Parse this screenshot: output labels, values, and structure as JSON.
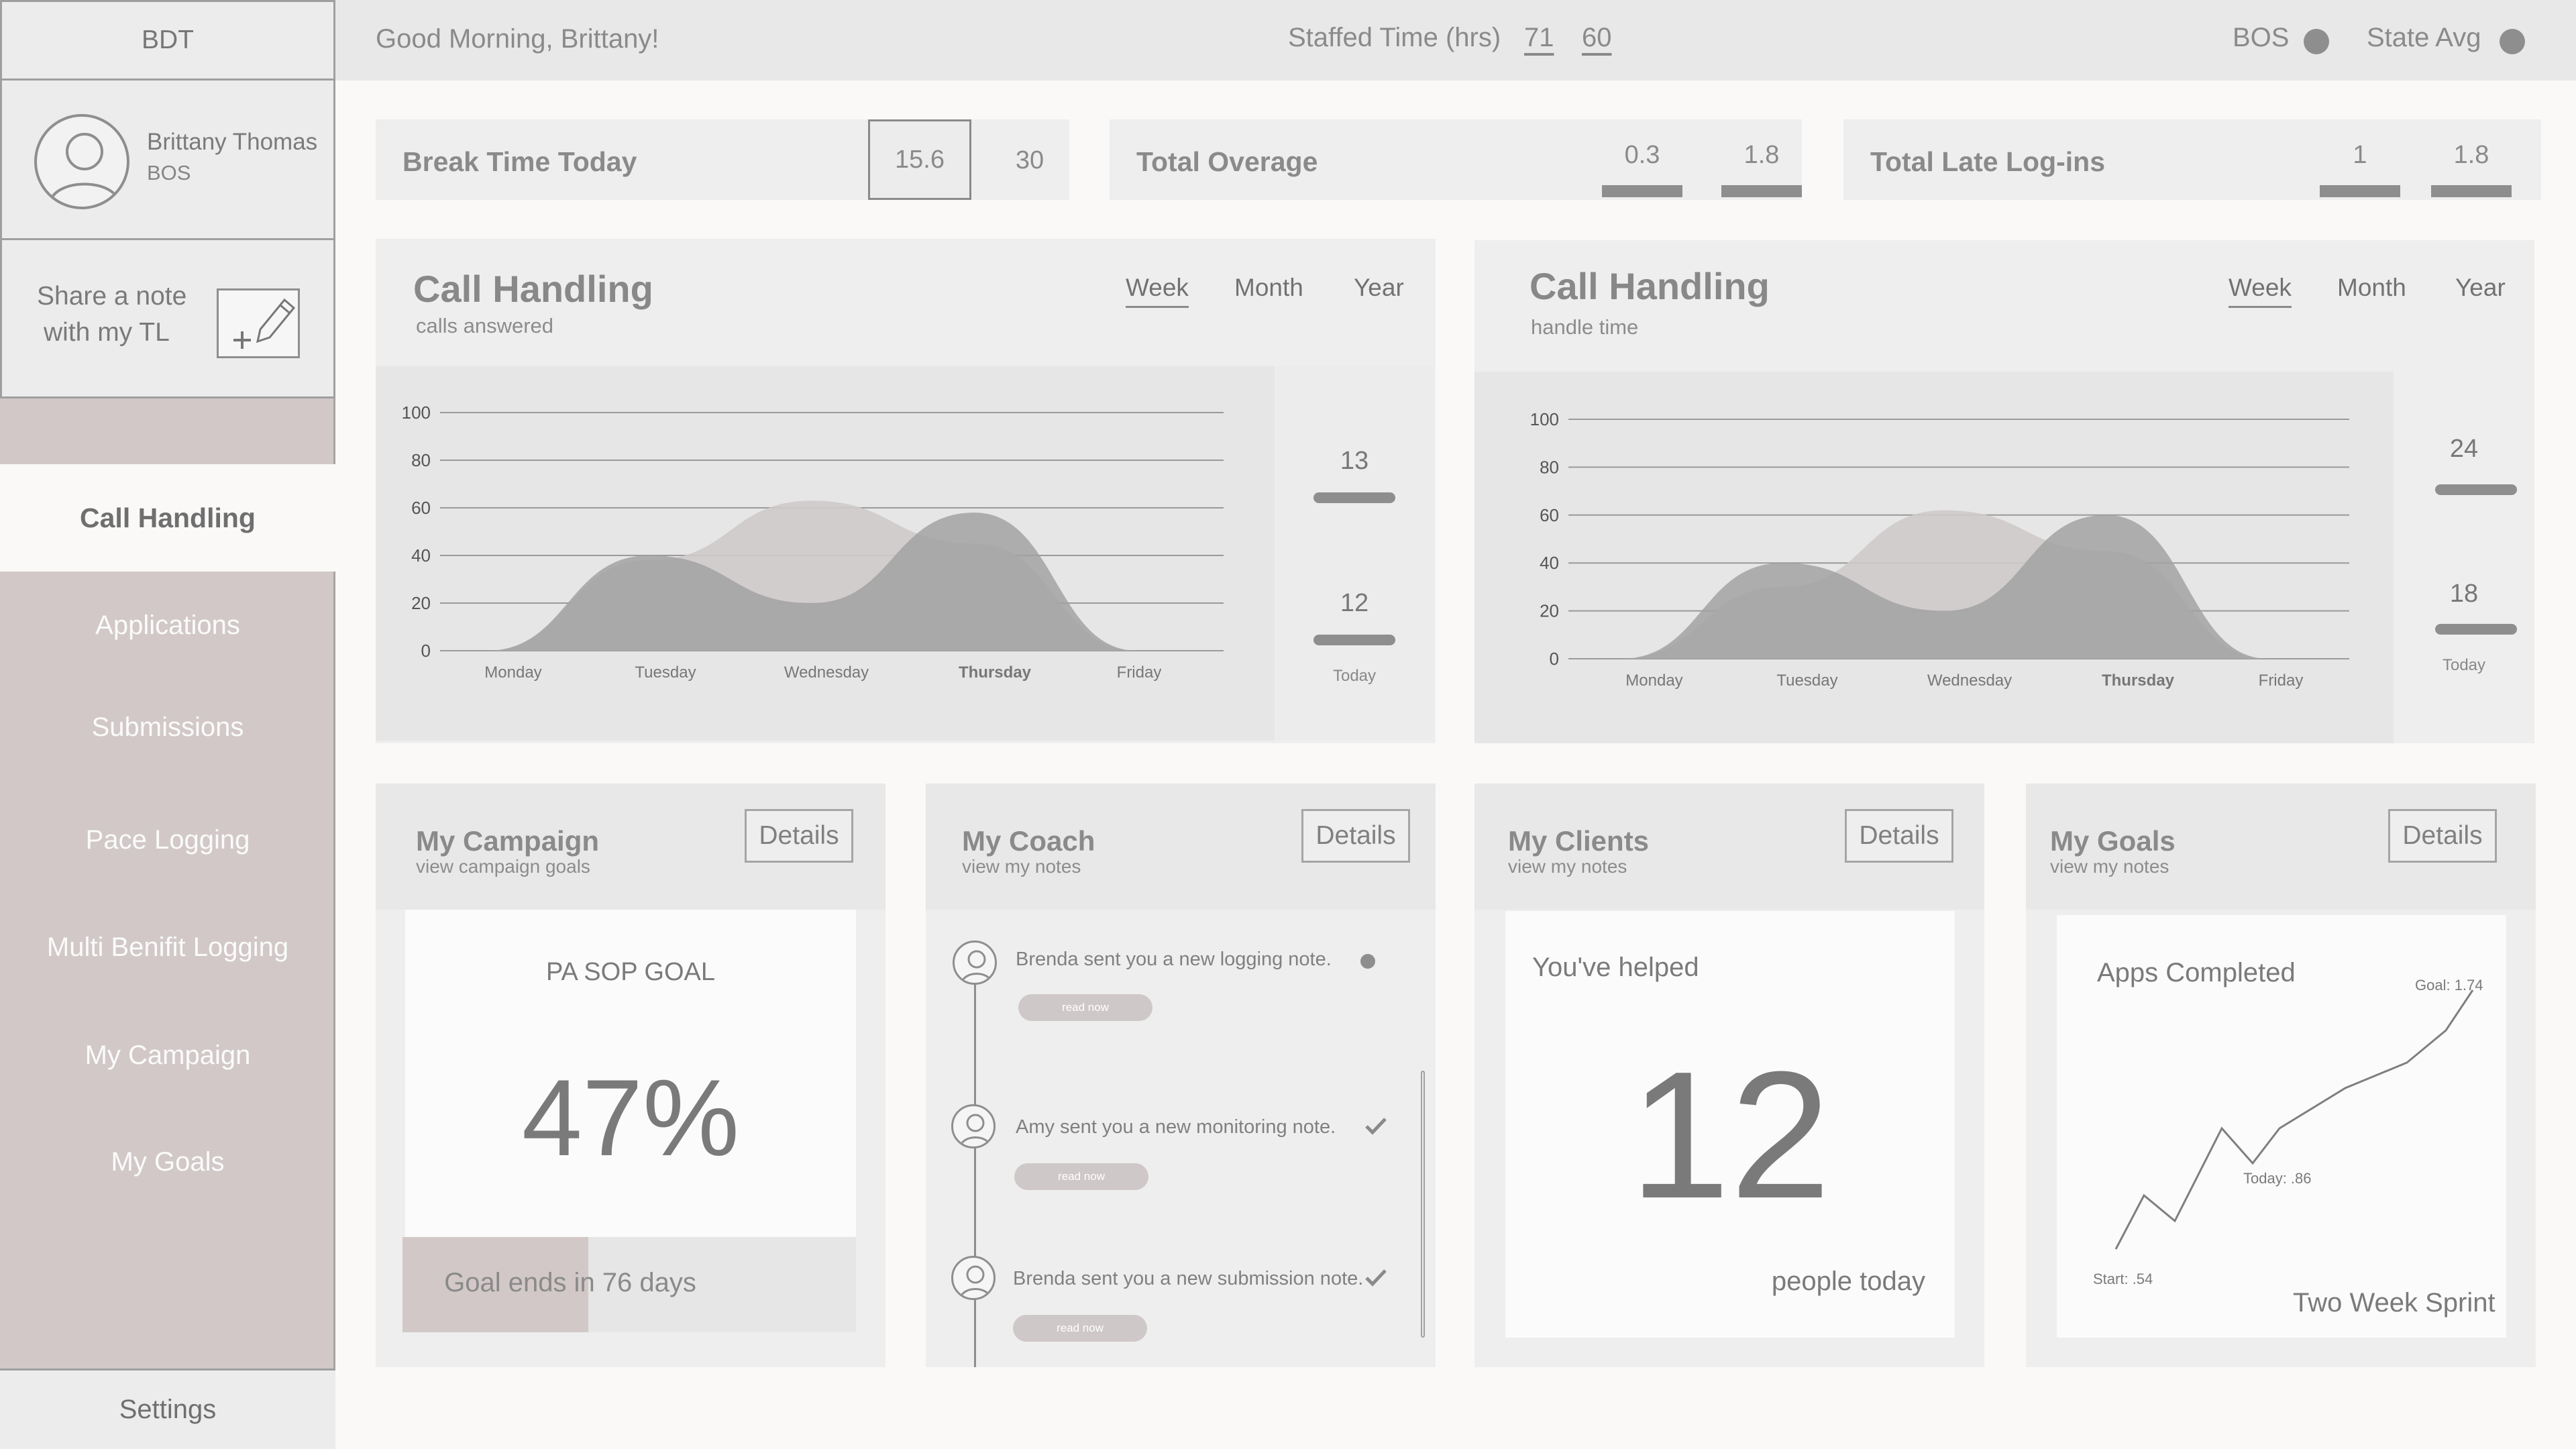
{
  "sidebar": {
    "brand": "BDT",
    "user_name": "Brittany Thomas",
    "user_role": "BOS",
    "share_line1": "Share a note",
    "share_line2": "with my TL",
    "active_item": "Call Handling",
    "items": [
      "Applications",
      "Submissions",
      "Pace Logging",
      "Multi Benifit Logging",
      "My Campaign",
      "My Goals"
    ],
    "settings": "Settings"
  },
  "topbar": {
    "greeting": "Good Morning, Brittany!",
    "staffed_label": "Staffed Time (hrs)",
    "staffed_values": [
      "71",
      "60"
    ],
    "legend_bos": "BOS",
    "legend_state": "State Avg"
  },
  "stats": {
    "break": {
      "label": "Break Time Today",
      "value": "15.6",
      "value2": "30"
    },
    "overage": {
      "label": "Total Overage",
      "value": "0.3",
      "value2": "1.8"
    },
    "late": {
      "label": "Total Late Log-ins",
      "value": "1",
      "value2": "1.8"
    }
  },
  "charts": [
    {
      "title": "Call Handling",
      "subtitle": "calls answered",
      "tabs": [
        "Week",
        "Month",
        "Year"
      ],
      "active_tab": "Week",
      "side_values": [
        "13",
        "12"
      ],
      "side_label": "Today"
    },
    {
      "title": "Call Handling",
      "subtitle": "handle time",
      "tabs": [
        "Week",
        "Month",
        "Year"
      ],
      "active_tab": "Week",
      "side_values": [
        "24",
        "18"
      ],
      "side_label": "Today"
    }
  ],
  "chart_data": [
    {
      "type": "area",
      "categories": [
        "Monday",
        "Tuesday",
        "Wednesday",
        "Thursday",
        "Friday"
      ],
      "highlighted_category": "Thursday",
      "y_ticks": [
        0,
        20,
        40,
        60,
        80,
        100
      ],
      "ylim": [
        0,
        100
      ],
      "grid": true,
      "series": [
        {
          "values": [
            0,
            38,
            63,
            45,
            0
          ],
          "color": "#cfcaca"
        },
        {
          "values": [
            0,
            40,
            20,
            58,
            0
          ],
          "color": "#a2a2a2"
        }
      ]
    },
    {
      "type": "area",
      "categories": [
        "Monday",
        "Tuesday",
        "Wednesday",
        "Thursday",
        "Friday"
      ],
      "highlighted_category": "Thursday",
      "y_ticks": [
        0,
        20,
        40,
        60,
        80,
        100
      ],
      "ylim": [
        0,
        100
      ],
      "grid": true,
      "series": [
        {
          "values": [
            0,
            30,
            62,
            45,
            0
          ],
          "color": "#cfcaca"
        },
        {
          "values": [
            0,
            40,
            20,
            60,
            0
          ],
          "color": "#a2a2a2"
        }
      ]
    }
  ],
  "cards": {
    "campaign": {
      "title": "My Campaign",
      "subtitle": "view campaign goals",
      "details": "Details",
      "goal_label": "PA SOP GOAL",
      "percent": "47%",
      "progress": 0.41,
      "footer": "Goal ends in 76 days"
    },
    "coach": {
      "title": "My Coach",
      "subtitle": "view my notes",
      "details": "Details",
      "notes": [
        {
          "text": "Brenda sent you a new logging note.",
          "action": "read now",
          "status": "unread"
        },
        {
          "text": "Amy sent you a new monitoring note.",
          "action": "read now",
          "status": "read"
        },
        {
          "text": "Brenda sent you a new submission note.",
          "action": "read now",
          "status": "read"
        }
      ]
    },
    "clients": {
      "title": "My Clients",
      "subtitle": "view my notes",
      "details": "Details",
      "helped_label": "You've helped",
      "number": "12",
      "footer": "people today"
    },
    "goals": {
      "title": "My Goals",
      "subtitle": "view my notes",
      "details": "Details",
      "label": "Apps Completed",
      "goal": "Goal: 1.74",
      "today": "Today: .86",
      "start": "Start: .54",
      "footer": "Two Week Sprint"
    }
  },
  "colors": {
    "sidebar": "#d2c8c8",
    "panel": "#efeeee",
    "accent_gray": "#8e8e8e"
  }
}
